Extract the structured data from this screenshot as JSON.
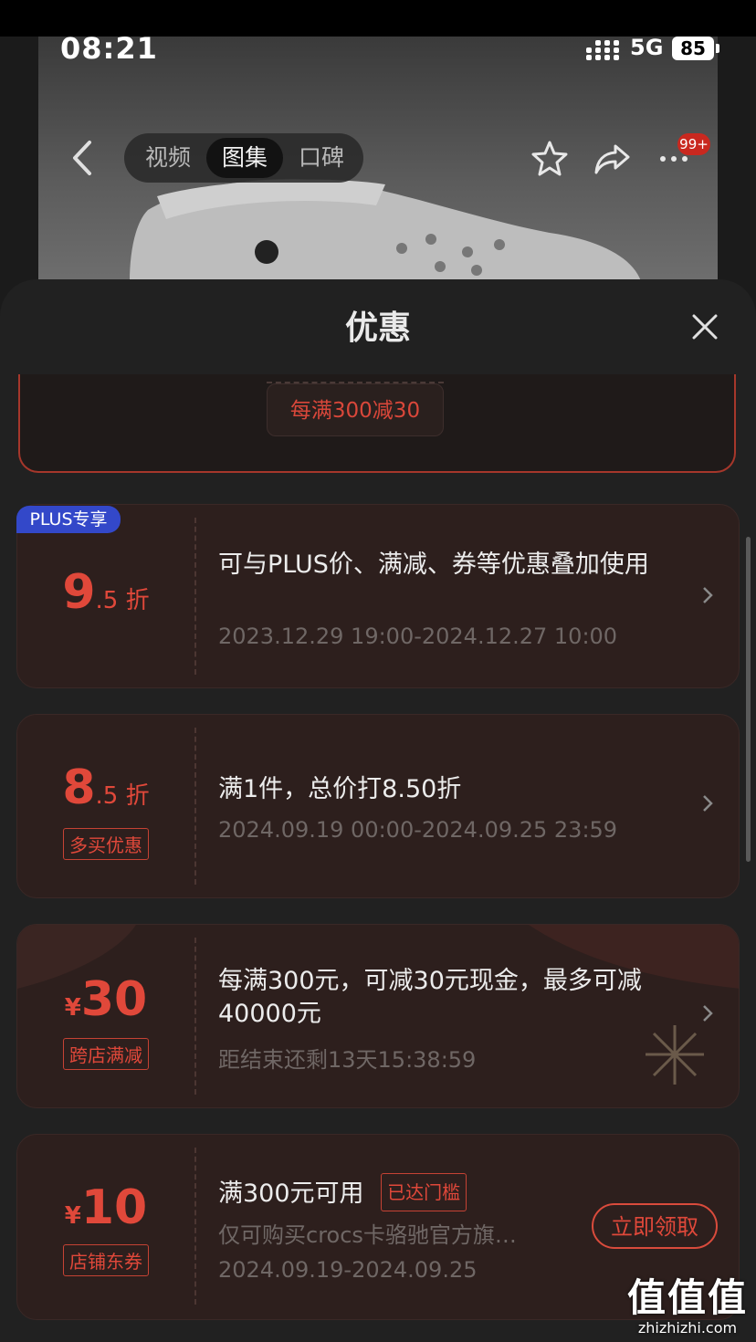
{
  "status_bar": {
    "time": "08:21",
    "network": "5G",
    "battery": "85"
  },
  "nav": {
    "tabs": [
      {
        "label": "视频",
        "active": false
      },
      {
        "label": "图集",
        "active": true
      },
      {
        "label": "口碑",
        "active": false
      }
    ],
    "badge": "99+"
  },
  "sheet": {
    "title": "优惠",
    "partial_tag": "每满300减30"
  },
  "offers": [
    {
      "plus_tag": "PLUS专享",
      "value_main": "9",
      "value_sub": ".5 折",
      "title": "可与PLUS价、满减、券等优惠叠加使用",
      "date": "2023.12.29 19:00-2024.12.27 10:00"
    },
    {
      "value_main": "8",
      "value_sub": ".5 折",
      "tag": "多买优惠",
      "title": "满1件，总价打8.50折",
      "date": "2024.09.19 00:00-2024.09.25 23:59"
    },
    {
      "currency": "¥",
      "value_main": "30",
      "tag": "跨店满减",
      "title": "每满300元，可减30元现金，最多可减40000元",
      "countdown": "距结束还剩13天15:38:59"
    },
    {
      "currency": "¥",
      "value_main": "10",
      "tag": "店铺东券",
      "title": "满300元可用",
      "threshold_tag": "已达门槛",
      "subtitle": "仅可购买crocs卡骆驰官方旗…",
      "date": "2024.09.19-2024.09.25",
      "button": "立即领取"
    }
  ],
  "watermark": {
    "logo": "值值值",
    "url": "zhizhizhi.com"
  },
  "colors": {
    "accent": "#e0483a",
    "plus": "#3348c9",
    "sheet_bg": "#212121",
    "card_bg": "#2d1f1d"
  }
}
